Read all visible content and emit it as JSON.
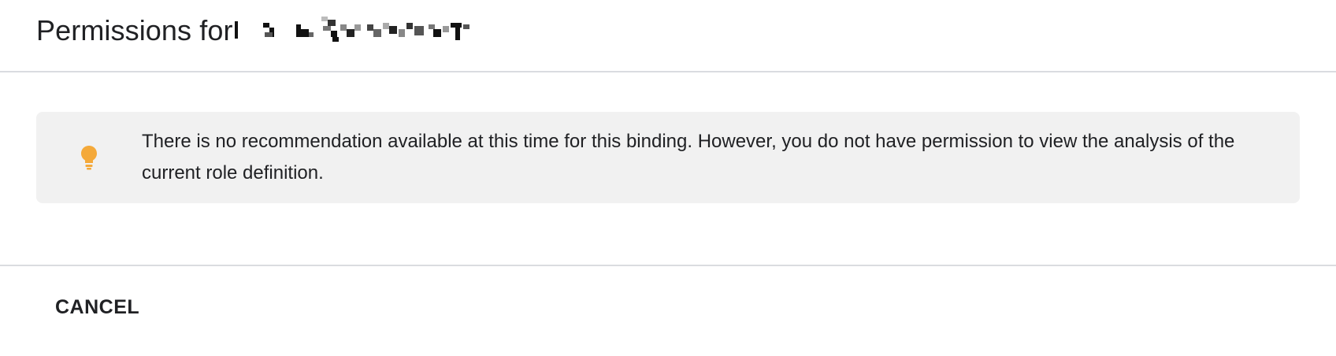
{
  "header": {
    "title_prefix": "Permissions for"
  },
  "notice": {
    "icon": "lightbulb-icon",
    "icon_color": "#f4a93a",
    "text": "There is no recommendation available at this time for this binding. However, you do not have permission to view the analysis of the current role definition."
  },
  "footer": {
    "cancel_label": "CANCEL"
  }
}
